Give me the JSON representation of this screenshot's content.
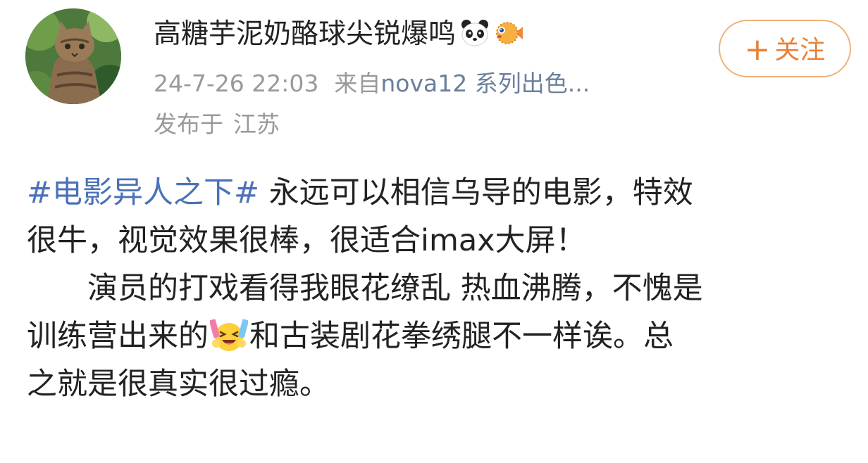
{
  "user": {
    "name": "高糖芋泥奶酪球尖锐爆鸣",
    "badges": [
      "panda-emoji",
      "pufferfish-emoji"
    ],
    "follow_label": "关注",
    "follow_plus": "+"
  },
  "meta": {
    "datetime": "24-7-26 22:03",
    "source_prefix": "来自",
    "device": "nova12 系列出色...",
    "published_prefix": "发布于",
    "location": "江苏"
  },
  "post": {
    "hashtag": "#电影异人之下#",
    "line1_rest": " 永远可以相信乌导的电影，特效",
    "line2": "很牛，视觉效果很棒，很适合imax大屏！",
    "line3": "演员的打戏看得我眼花缭乱 热血沸腾，不愧是",
    "line4_before_emoji": "训练营出来的",
    "line4_after_emoji": "和古装剧花拳绣腿不一样诶。总",
    "line5": "之就是很真实很过瘾。",
    "emoji": "laughing-cheering-emoji"
  },
  "colors": {
    "hashtag": "#4a72b8",
    "follow_accent": "#e8823a",
    "meta_gray": "#9a9a9a"
  }
}
